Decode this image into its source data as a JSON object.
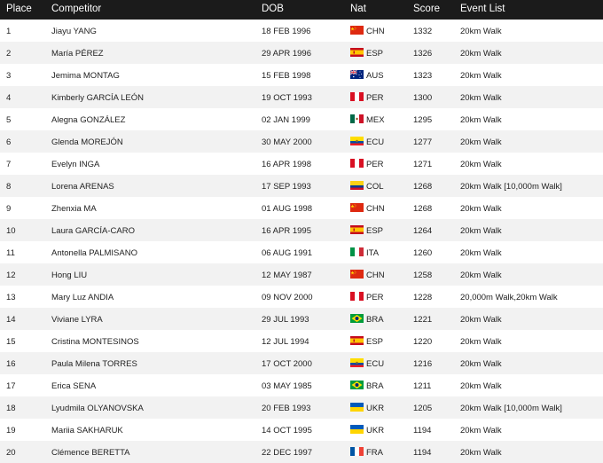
{
  "headers": {
    "place": "Place",
    "competitor": "Competitor",
    "dob": "DOB",
    "nat": "Nat",
    "score": "Score",
    "events": "Event List"
  },
  "flags": {
    "CHN": "flag-china",
    "ESP": "flag-spain",
    "AUS": "flag-australia",
    "PER": "flag-peru",
    "MEX": "flag-mexico",
    "ECU": "flag-ecuador",
    "COL": "flag-colombia",
    "ITA": "flag-italy",
    "BRA": "flag-brazil",
    "UKR": "flag-ukraine",
    "FRA": "flag-france"
  },
  "rows": [
    {
      "place": "1",
      "competitor": "Jiayu YANG",
      "dob": "18 FEB 1996",
      "nat": "CHN",
      "score": "1332",
      "events": "20km Walk"
    },
    {
      "place": "2",
      "competitor": "María PÉREZ",
      "dob": "29 APR 1996",
      "nat": "ESP",
      "score": "1326",
      "events": "20km Walk"
    },
    {
      "place": "3",
      "competitor": "Jemima MONTAG",
      "dob": "15 FEB 1998",
      "nat": "AUS",
      "score": "1323",
      "events": "20km Walk"
    },
    {
      "place": "4",
      "competitor": "Kimberly GARCÍA LEÓN",
      "dob": "19 OCT 1993",
      "nat": "PER",
      "score": "1300",
      "events": "20km Walk"
    },
    {
      "place": "5",
      "competitor": "Alegna GONZÁLEZ",
      "dob": "02 JAN 1999",
      "nat": "MEX",
      "score": "1295",
      "events": "20km Walk"
    },
    {
      "place": "6",
      "competitor": "Glenda MOREJÓN",
      "dob": "30 MAY 2000",
      "nat": "ECU",
      "score": "1277",
      "events": "20km Walk"
    },
    {
      "place": "7",
      "competitor": "Evelyn INGA",
      "dob": "16 APR 1998",
      "nat": "PER",
      "score": "1271",
      "events": "20km Walk"
    },
    {
      "place": "8",
      "competitor": "Lorena ARENAS",
      "dob": "17 SEP 1993",
      "nat": "COL",
      "score": "1268",
      "events": "20km Walk [10,000m Walk]"
    },
    {
      "place": "9",
      "competitor": "Zhenxia MA",
      "dob": "01 AUG 1998",
      "nat": "CHN",
      "score": "1268",
      "events": "20km Walk"
    },
    {
      "place": "10",
      "competitor": "Laura GARCÍA-CARO",
      "dob": "16 APR 1995",
      "nat": "ESP",
      "score": "1264",
      "events": "20km Walk"
    },
    {
      "place": "11",
      "competitor": "Antonella PALMISANO",
      "dob": "06 AUG 1991",
      "nat": "ITA",
      "score": "1260",
      "events": "20km Walk"
    },
    {
      "place": "12",
      "competitor": "Hong LIU",
      "dob": "12 MAY 1987",
      "nat": "CHN",
      "score": "1258",
      "events": "20km Walk"
    },
    {
      "place": "13",
      "competitor": "Mary Luz ANDIA",
      "dob": "09 NOV 2000",
      "nat": "PER",
      "score": "1228",
      "events": "20,000m Walk,20km Walk"
    },
    {
      "place": "14",
      "competitor": "Viviane LYRA",
      "dob": "29 JUL 1993",
      "nat": "BRA",
      "score": "1221",
      "events": "20km Walk"
    },
    {
      "place": "15",
      "competitor": "Cristina MONTESINOS",
      "dob": "12 JUL 1994",
      "nat": "ESP",
      "score": "1220",
      "events": "20km Walk"
    },
    {
      "place": "16",
      "competitor": "Paula Milena TORRES",
      "dob": "17 OCT 2000",
      "nat": "ECU",
      "score": "1216",
      "events": "20km Walk"
    },
    {
      "place": "17",
      "competitor": "Erica SENA",
      "dob": "03 MAY 1985",
      "nat": "BRA",
      "score": "1211",
      "events": "20km Walk"
    },
    {
      "place": "18",
      "competitor": "Lyudmila OLYANOVSKA",
      "dob": "20 FEB 1993",
      "nat": "UKR",
      "score": "1205",
      "events": "20km Walk [10,000m Walk]"
    },
    {
      "place": "19",
      "competitor": "Mariia SAKHARUK",
      "dob": "14 OCT 1995",
      "nat": "UKR",
      "score": "1194",
      "events": "20km Walk"
    },
    {
      "place": "20",
      "competitor": "Clémence BERETTA",
      "dob": "22 DEC 1997",
      "nat": "FRA",
      "score": "1194",
      "events": "20km Walk"
    }
  ]
}
